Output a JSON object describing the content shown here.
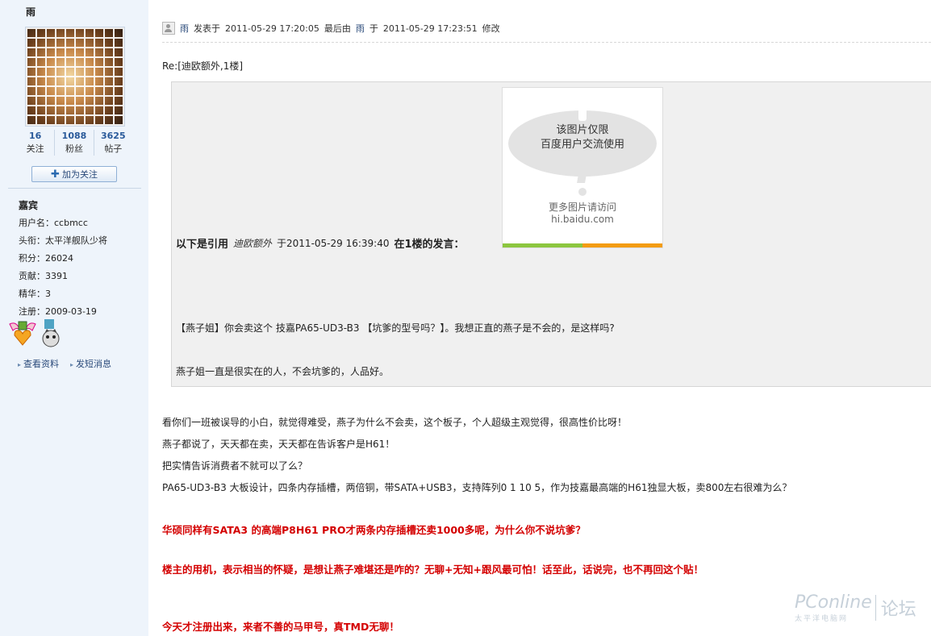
{
  "profile": {
    "username": "雨",
    "stats": [
      {
        "num": "16",
        "label": "关注"
      },
      {
        "num": "1088",
        "label": "粉丝"
      },
      {
        "num": "3625",
        "label": "帖子"
      }
    ],
    "follow_button": "加为关注",
    "rank_title": "嘉宾",
    "fields": [
      "用户名：ccbmcc",
      "头衔：太平洋舰队少将",
      "积分：26024",
      "贡献：3391",
      "精华：3",
      "注册：2009-03-19"
    ],
    "links": [
      "查看资料",
      "发短消息"
    ]
  },
  "post": {
    "author": "雨",
    "posted_label": "发表于",
    "posted_time": "2011-05-29 17:20:05",
    "edited_label": "最后由",
    "editor": "雨",
    "at_label": "于",
    "edited_time": "2011-05-29 17:23:51",
    "modify_label": "修改",
    "reply_title": "Re:[迪欧额外,1楼]"
  },
  "quote": {
    "image_text_1": "该图片仅限",
    "image_text_2": "百度用户交流使用",
    "image_text_3": "更多图片请访问",
    "image_text_4": "hi.baidu.com",
    "head_prefix": "以下是引用",
    "head_user": "迪欧额外",
    "head_time": "于2011-05-29 16:39:40",
    "head_suffix": "在1楼的发言：",
    "line1": "【燕子姐】你会卖这个 技嘉PA65-UD3-B3 【坑爹的型号吗？】。我想正直的燕子是不会的，是这样吗?",
    "line2": "燕子姐一直是很实在的人，不会坑爹的，人品好。"
  },
  "body": {
    "p1": "看你们一班被误导的小白，就觉得难受，燕子为什么不会卖，这个板子，个人超级主观觉得，很高性价比呀！",
    "p2": "燕子都说了，天天都在卖，天天都在告诉客户是H61！",
    "p3": "把实情告诉消费者不就可以了么？",
    "p4": "PA65-UD3-B3 大板设计，四条内存插槽，两倍铜，带SATA+USB3，支持阵列0 1 10 5，作为技嘉最高端的H61独显大板，卖800左右很难为么？",
    "r1": "华硕同样有SATA3 的高端P8H61 PRO才两条内存插槽还卖1000多呢，为什么你不说坑爹？",
    "r2": "楼主的用机，表示相当的怀疑，是想让燕子难堪还是咋的？无聊+无知+跟风最可怕！话至此，话说完，也不再回这个贴！",
    "r3": "今天才注册出来，来者不善的马甲号，真TMD无聊！"
  },
  "watermark": {
    "brand": "PConline",
    "sub": "太平洋电脑网",
    "section": "论坛"
  }
}
